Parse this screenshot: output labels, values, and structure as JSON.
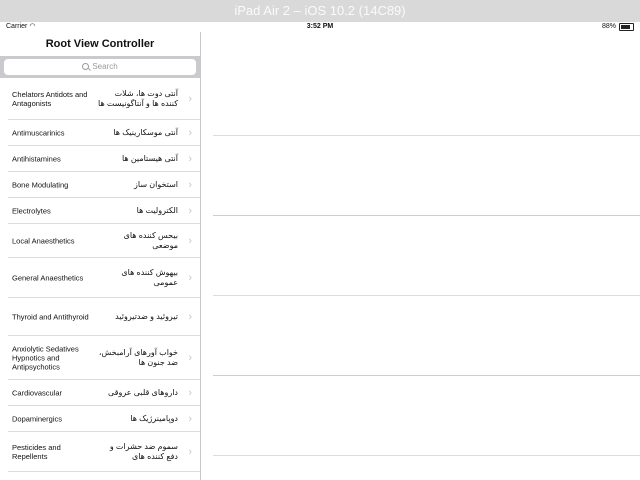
{
  "window": {
    "title": "iPad Air 2 – iOS 10.2 (14C89)"
  },
  "statusbar": {
    "carrier": "Carrier",
    "time": "3:52 PM",
    "battery": "88%"
  },
  "master": {
    "nav_title": "Root View Controller",
    "search_placeholder": "Search",
    "rows": [
      {
        "en": "Chelators Antidots and Antagonists",
        "fa": "آنتی دوت ها، شلات کننده ها و آنتاگونیست ها"
      },
      {
        "en": "Antimuscarinics",
        "fa": "آنتی موسکارینیک ها"
      },
      {
        "en": "Antihistamines",
        "fa": "آنتی هیستامین ها"
      },
      {
        "en": "Bone Modulating",
        "fa": "استخوان ساز"
      },
      {
        "en": "Electrolytes",
        "fa": "الکترولیت ها"
      },
      {
        "en": "Local Anaesthetics",
        "fa": "بیحس کننده های موضعی"
      },
      {
        "en": "General Anaesthetics",
        "fa": "بیهوش کننده های عمومی"
      },
      {
        "en": "Thyroid and Antithyroid",
        "fa": "تیروئید و ضدتیروئید"
      },
      {
        "en": "Anxiolytic Sedatives Hypnotics and Antipsychotics",
        "fa": "خواب آورهای آرامبخش، ضد جنون ها"
      },
      {
        "en": "Cardiovascular",
        "fa": "داروهای قلبی عروقی"
      },
      {
        "en": "Dopaminergics",
        "fa": "دوپامینرژیک ها"
      },
      {
        "en": "Pesticides and Repellents",
        "fa": "سموم ضد حشرات و دفع کننده های"
      }
    ]
  },
  "detail": {
    "line_colors": [
      "#e3dfb6",
      "#c9cbe6",
      "#e3dfb6",
      "#c9cbe6",
      "#e3dfb6"
    ]
  }
}
